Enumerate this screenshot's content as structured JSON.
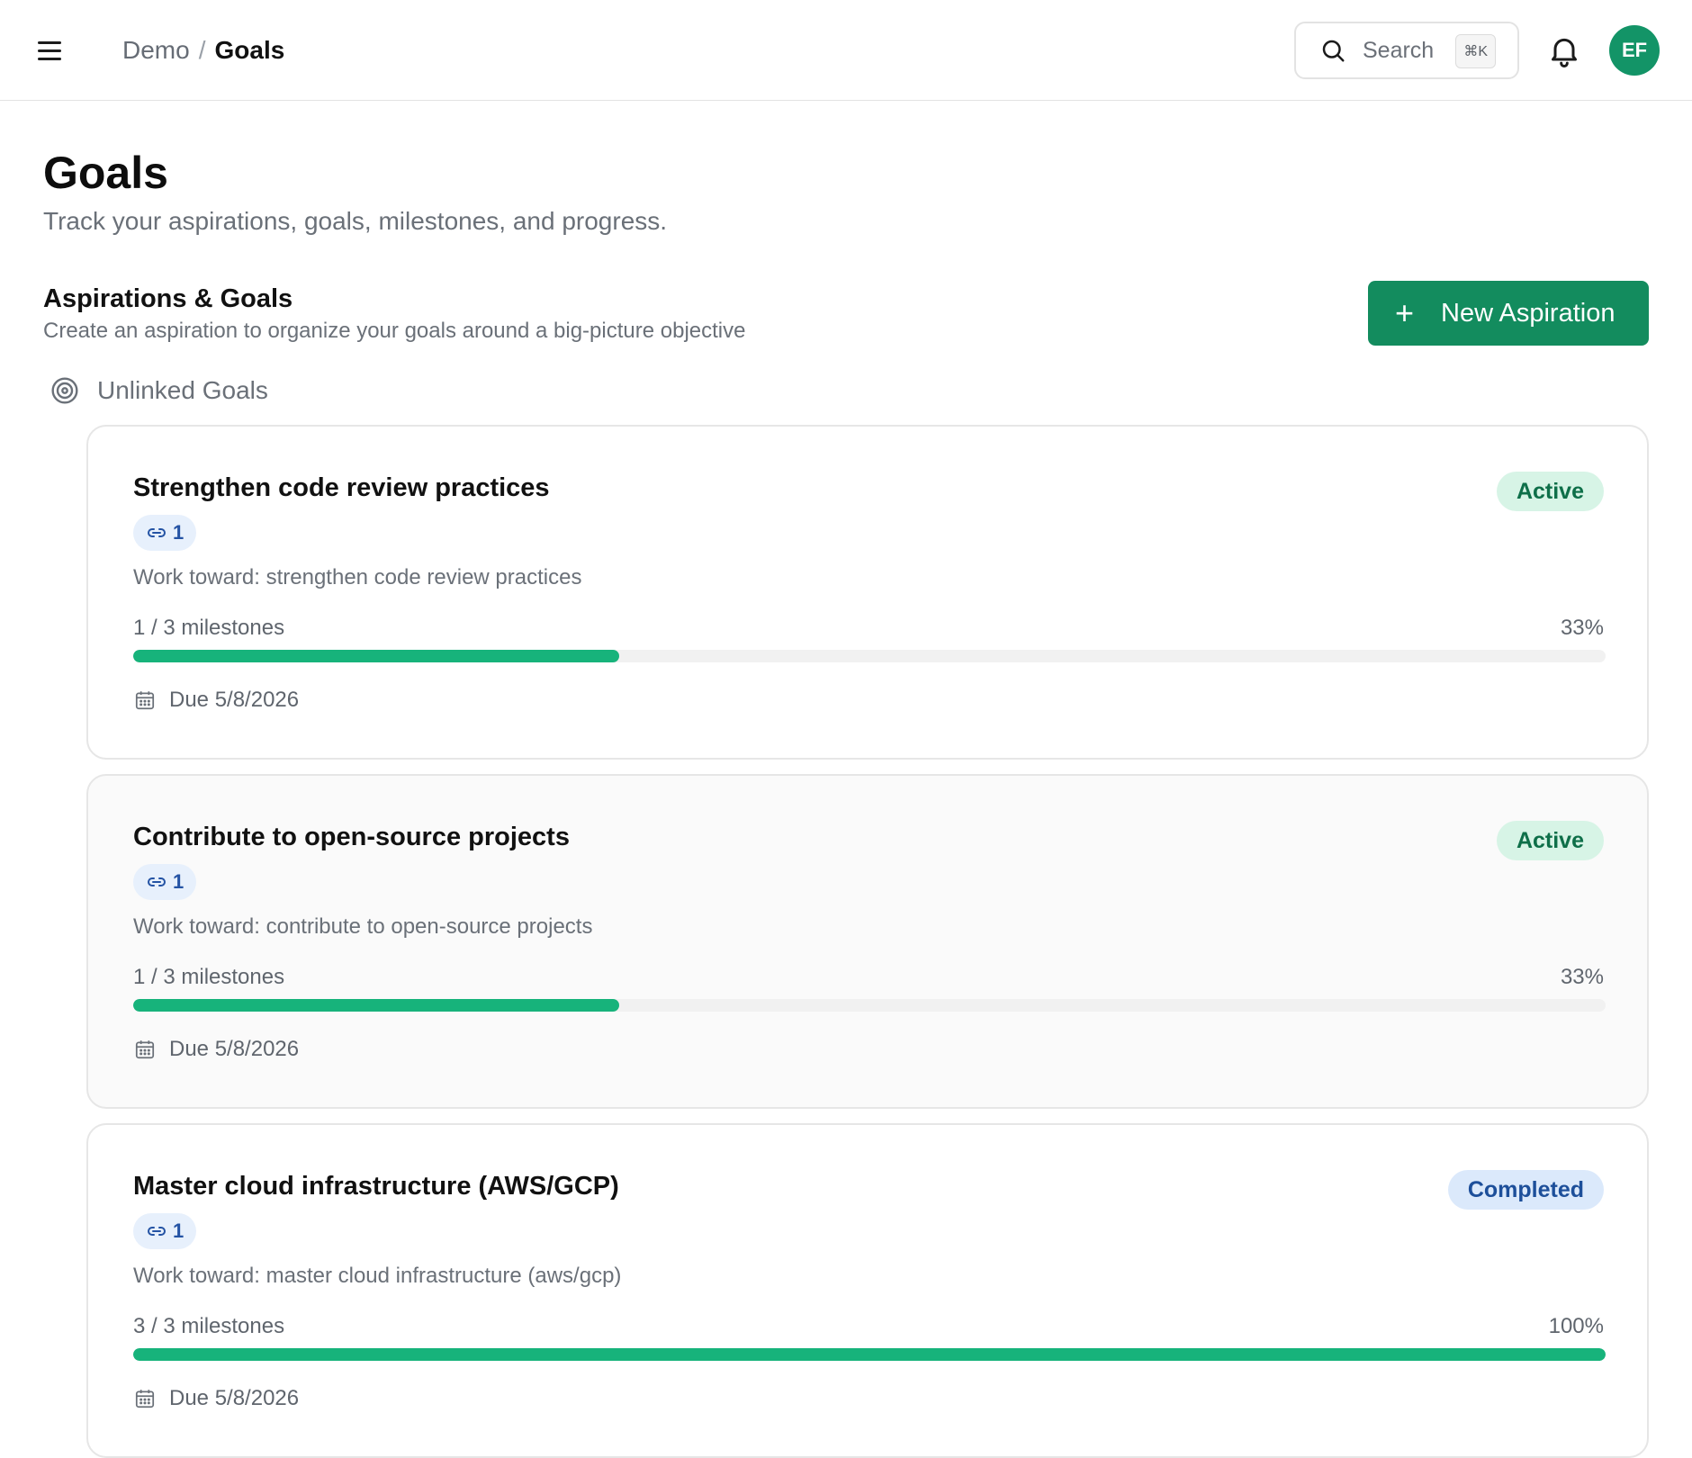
{
  "header": {
    "breadcrumb": {
      "root": "Demo",
      "separator": "/",
      "current": "Goals"
    },
    "search": {
      "label": "Search",
      "shortcut": "⌘K"
    },
    "avatar_initials": "EF"
  },
  "page": {
    "title": "Goals",
    "subtitle": "Track your aspirations, goals, milestones, and progress."
  },
  "section": {
    "title": "Aspirations & Goals",
    "description": "Create an aspiration to organize your goals around a big-picture objective",
    "new_button_label": "New Aspiration"
  },
  "group": {
    "label": "Unlinked Goals"
  },
  "goals": [
    {
      "title": "Strengthen code review practices",
      "status": "Active",
      "link_count": "1",
      "description": "Work toward: strengthen code review practices",
      "milestones_text": "1 / 3 milestones",
      "percent_text": "33%",
      "progress": 0.33,
      "due_text": "Due 5/8/2026"
    },
    {
      "title": "Contribute to open-source projects",
      "status": "Active",
      "link_count": "1",
      "description": "Work toward: contribute to open-source projects",
      "milestones_text": "1 / 3 milestones",
      "percent_text": "33%",
      "progress": 0.33,
      "due_text": "Due 5/8/2026"
    },
    {
      "title": "Master cloud infrastructure (AWS/GCP)",
      "status": "Completed",
      "link_count": "1",
      "description": "Work toward: master cloud infrastructure (aws/gcp)",
      "milestones_text": "3 / 3 milestones",
      "percent_text": "100%",
      "progress": 1.0,
      "due_text": "Due 5/8/2026"
    }
  ],
  "colors": {
    "brand_green": "#138c5e",
    "progress_green": "#17b37b",
    "active_badge_bg": "#d7f4e6",
    "completed_badge_bg": "#dbe9fb"
  },
  "icons": [
    "menu-icon",
    "search-icon",
    "bell-icon",
    "target-icon",
    "plus-icon",
    "link-icon",
    "calendar-icon"
  ]
}
